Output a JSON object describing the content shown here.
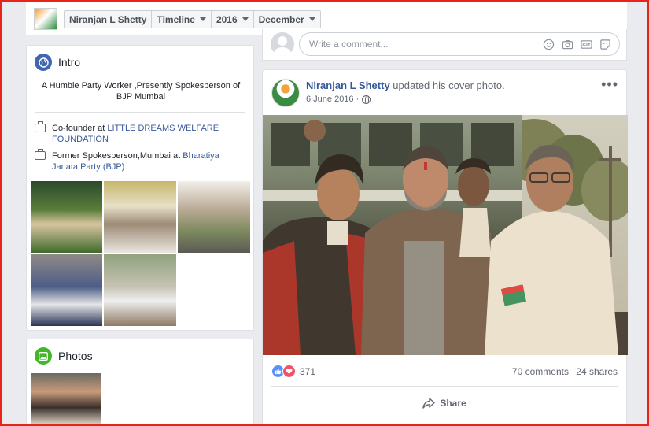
{
  "breadcrumb": {
    "name": "Niranjan L Shetty",
    "view": "Timeline",
    "year": "2016",
    "month": "December"
  },
  "composer": {
    "placeholder": "Write a comment...",
    "icons": [
      "emoji-icon",
      "camera-icon",
      "gif-icon",
      "sticker-icon"
    ]
  },
  "intro": {
    "title": "Intro",
    "bio": "A Humble Party Worker ,Presently Spokesperson of BJP Mumbai",
    "work": [
      {
        "prefix": "Co-founder at ",
        "org": "LITTLE DREAMS WELFARE FOUNDATION"
      },
      {
        "prefix": "Former Spokesperson,Mumbai at ",
        "org": "Bharatiya Janata Party (BJP)"
      }
    ]
  },
  "photos": {
    "title": "Photos"
  },
  "post": {
    "author": "Niranjan L Shetty",
    "action": " updated his cover photo.",
    "date": "6 June 2016 · ",
    "reaction_count": "371",
    "comments": "70 comments",
    "shares": "24 shares",
    "share_label": "Share"
  },
  "colors": {
    "link": "#365899",
    "frame": "#e8231a",
    "intro_icon": "#4267b2",
    "photos_icon": "#42b72a"
  }
}
